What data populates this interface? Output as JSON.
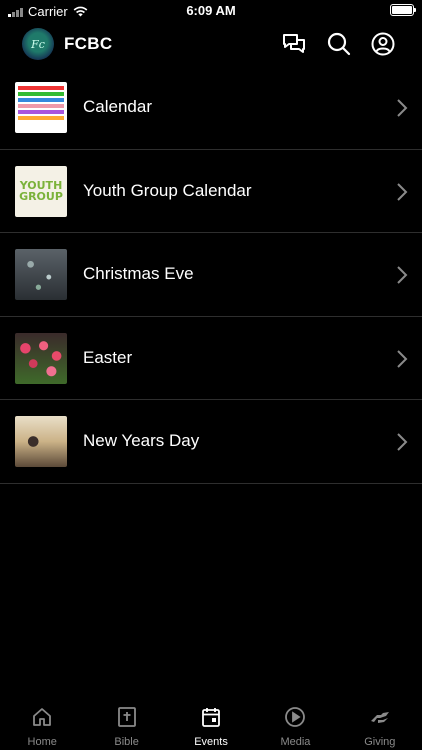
{
  "status_bar": {
    "carrier": "Carrier",
    "time": "6:09 AM"
  },
  "header": {
    "logo_text": "Fc",
    "title": "FCBC",
    "icons": [
      "chat-icon",
      "search-icon",
      "profile-icon"
    ]
  },
  "events": [
    {
      "label": "Calendar",
      "thumb": "calendar"
    },
    {
      "label": "Youth Group Calendar",
      "thumb": "youth",
      "thumb_text_1": "YOUTH",
      "thumb_text_2": "GROUP"
    },
    {
      "label": "Christmas Eve",
      "thumb": "xmas"
    },
    {
      "label": "Easter",
      "thumb": "easter"
    },
    {
      "label": "New Years Day",
      "thumb": "newyear"
    }
  ],
  "tabs": [
    {
      "label": "Home",
      "icon": "home-icon",
      "active": false
    },
    {
      "label": "Bible",
      "icon": "bible-icon",
      "active": false
    },
    {
      "label": "Events",
      "icon": "events-icon",
      "active": true
    },
    {
      "label": "Media",
      "icon": "media-icon",
      "active": false
    },
    {
      "label": "Giving",
      "icon": "giving-icon",
      "active": false
    }
  ],
  "colors": {
    "background": "#000000",
    "inactive_tab": "#8a8a8a",
    "active_tab": "#ffffff",
    "divider": "#2e2e2e"
  }
}
